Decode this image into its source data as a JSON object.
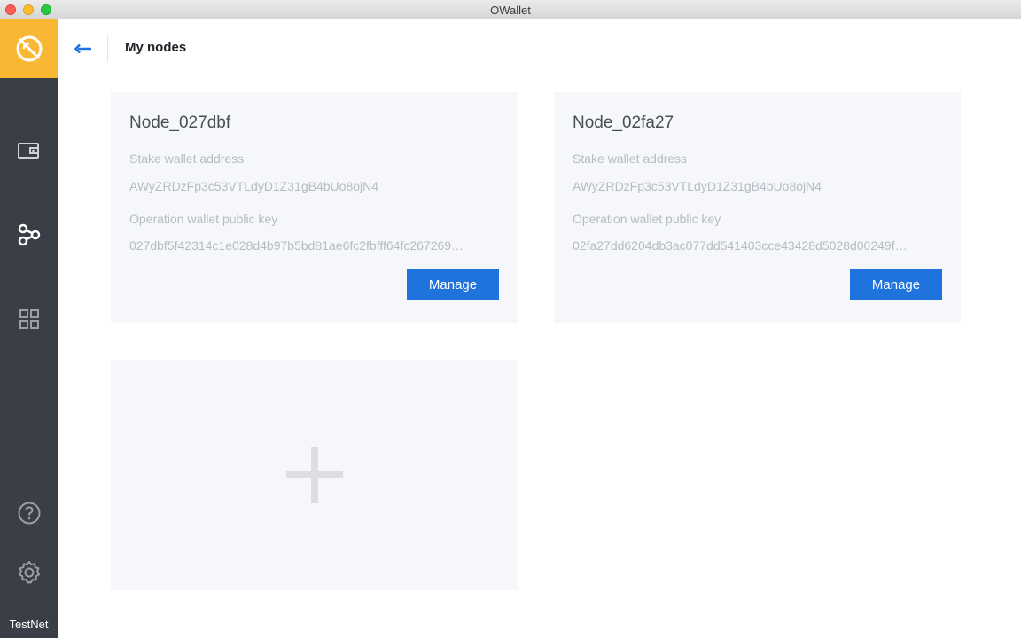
{
  "window": {
    "title": "OWallet"
  },
  "sidebar": {
    "logo_icon": "owallet-logo-icon",
    "items": [
      {
        "icon": "wallet-icon"
      },
      {
        "icon": "nodes-icon",
        "active": true
      },
      {
        "icon": "dapps-grid-icon"
      }
    ],
    "bottom_items": [
      {
        "icon": "help-icon"
      },
      {
        "icon": "settings-icon"
      }
    ],
    "network_label": "TestNet"
  },
  "header": {
    "back_icon": "back-arrow-icon",
    "title": "My nodes"
  },
  "nodes": [
    {
      "name": "Node_027dbf",
      "stake_label": "Stake wallet address",
      "stake_address": "AWyZRDzFp3c53VTLdyD1Z31gB4bUo8ojN4",
      "operation_label": "Operation wallet public key",
      "operation_key": "027dbf5f42314c1e028d4b97b5bd81ae6fc2fbfff64fc267269…",
      "manage_label": "Manage"
    },
    {
      "name": "Node_02fa27",
      "stake_label": "Stake wallet address",
      "stake_address": "AWyZRDzFp3c53VTLdyD1Z31gB4bUo8ojN4",
      "operation_label": "Operation wallet public key",
      "operation_key": "02fa27dd6204db3ac077dd541403cce43428d5028d00249f…",
      "manage_label": "Manage"
    }
  ],
  "add_node": {
    "icon": "plus-icon"
  },
  "colors": {
    "accent": "#1f73dc",
    "logo_bg": "#f9b833",
    "sidebar_bg": "#3a3e46",
    "card_bg": "#f6f7fa"
  }
}
